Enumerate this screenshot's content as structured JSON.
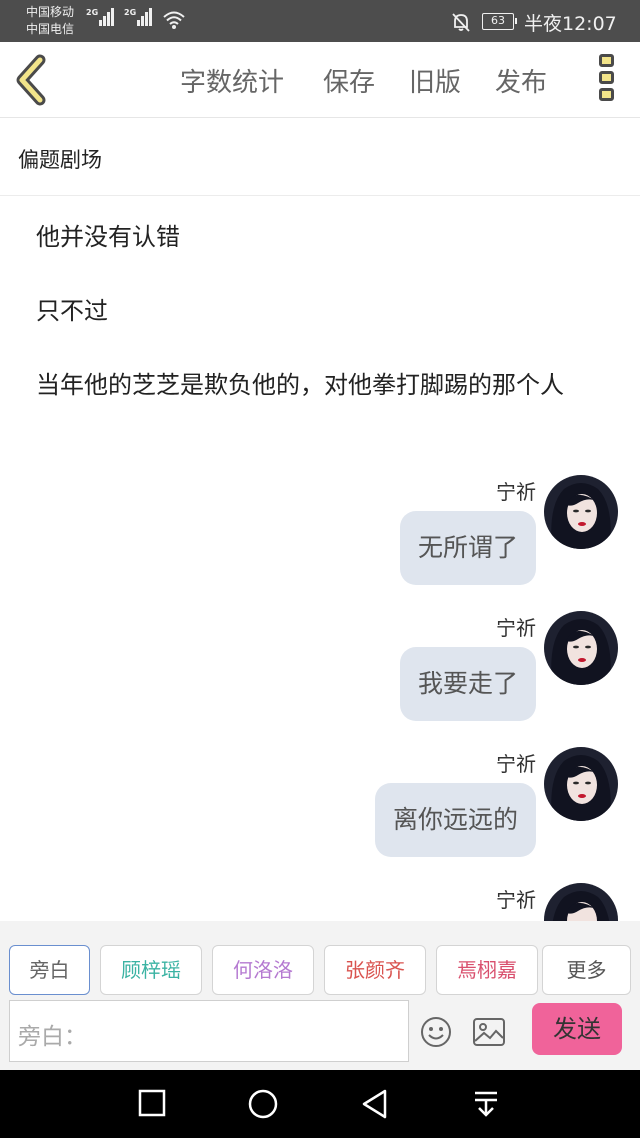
{
  "status_bar": {
    "carrier_1": "中国移动",
    "carrier_2": "中国电信",
    "signal_1_label": "2G",
    "signal_2_label": "2G",
    "battery_level": "63",
    "time": "半夜12:07"
  },
  "header": {
    "actions": [
      "字数统计",
      "保存",
      "旧版",
      "发布"
    ]
  },
  "section": {
    "title": "偏题剧场"
  },
  "narration": [
    "他并没有认错",
    "只不过",
    "当年他的芝芝是欺负他的，对他拳打脚踢的那个人"
  ],
  "messages": [
    {
      "name": "宁祈",
      "text": "无所谓了"
    },
    {
      "name": "宁祈",
      "text": "我要走了"
    },
    {
      "name": "宁祈",
      "text": "离你远远的"
    },
    {
      "name": "宁祈",
      "text": ""
    }
  ],
  "characters": [
    {
      "label": "旁白",
      "color": "#666666"
    },
    {
      "label": "顾梓瑶",
      "color": "#3bb3a3"
    },
    {
      "label": "何洛洛",
      "color": "#b57ad1"
    },
    {
      "label": "张颜齐",
      "color": "#d9534f"
    },
    {
      "label": "焉栩嘉",
      "color": "#d9506e"
    },
    {
      "label": "更多",
      "color": "#555555"
    }
  ],
  "composer": {
    "placeholder": "旁白：",
    "send_label": "发送"
  },
  "colors": {
    "accent_yellow": "#f2e48a",
    "send_pink": "#f0639a",
    "bubble": "#dfe5ee"
  }
}
